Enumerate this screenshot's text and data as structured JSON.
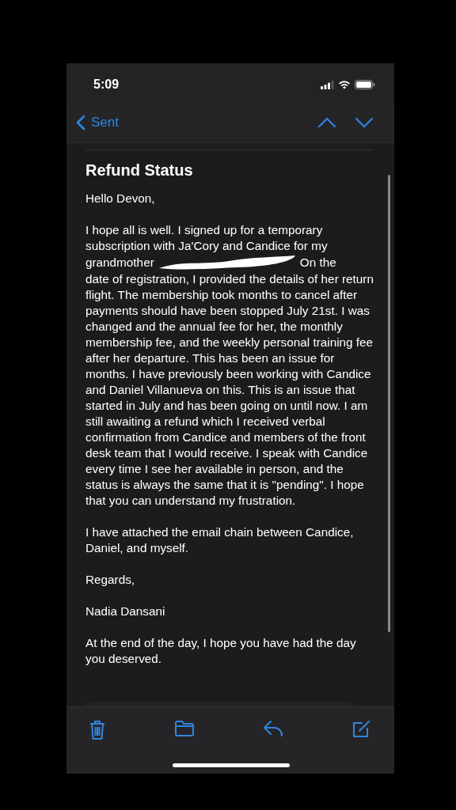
{
  "status_bar": {
    "time": "5:09"
  },
  "nav_bar": {
    "back_label": "Sent"
  },
  "email": {
    "subject": "Refund Status",
    "paragraphs": [
      {
        "kind": "text",
        "text": "Hello Devon,"
      },
      {
        "kind": "redacted",
        "before": "I hope all is well. I signed up for a temporary subscription with Ja'Cory and Candice for my",
        "line_start": "grandmother",
        "line_end": "On the",
        "after": "date of registration, I provided the details of her return flight. The membership took months to cancel after payments should have been stopped July 21st. I was changed and the annual fee for her, the monthly membership fee, and the weekly personal training fee after her departure. This has been an issue for months. I have previously been working with Candice and Daniel Villanueva on this. This is an issue that started in July and has been going on until now. I am still awaiting a refund which I received verbal confirmation from Candice and members of the front desk team that I would receive. I speak with Candice every time I see her available in person, and the status is always the same that it is \"pending\". I hope that you can understand my frustration."
      },
      {
        "kind": "text",
        "text": "I have attached the email chain between Candice, Daniel, and myself."
      },
      {
        "kind": "text",
        "text": "Regards,"
      },
      {
        "kind": "text",
        "text": "Nadia Dansani"
      },
      {
        "kind": "text",
        "text": "At the end of the day, I hope you have had the day you deserved."
      }
    ]
  }
}
